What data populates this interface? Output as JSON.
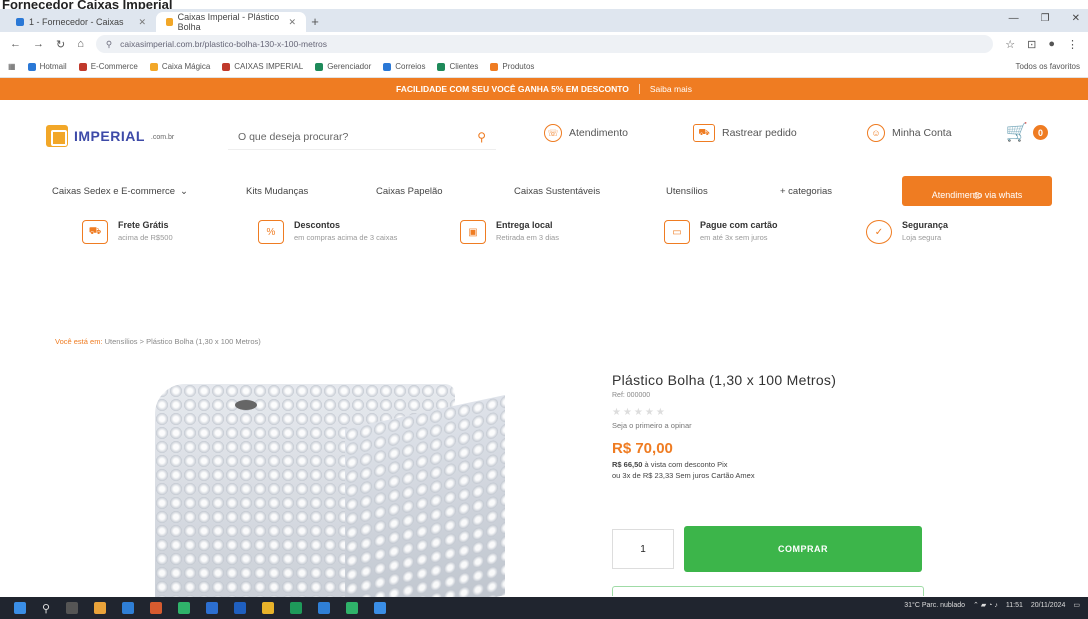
{
  "caption": "Fornecedor Caixas Imperial",
  "browser": {
    "tabs": [
      {
        "label": "1 - Fornecedor - Caixas",
        "active": false,
        "color": "#2a78d6"
      },
      {
        "label": "Caixas Imperial - Plástico Bolha",
        "active": true,
        "color": "#f2a728"
      }
    ],
    "new_tab": "+",
    "url": "caixasimperial.com.br/plastico-bolha-130-x-100-metros",
    "bookmarks": [
      {
        "label": "Hotmail",
        "color": "#2a78d6"
      },
      {
        "label": "E-Commerce",
        "color": "#c0392b"
      },
      {
        "label": "Caixa Mágica",
        "color": "#f2a728"
      },
      {
        "label": "CAIXAS IMPERIAL",
        "color": "#c0392b"
      },
      {
        "label": "Gerenciador",
        "color": "#1e8a5a"
      },
      {
        "label": "Correios",
        "color": "#2a78d6"
      },
      {
        "label": "Clientes",
        "color": "#1e8a5a"
      },
      {
        "label": "Produtos",
        "color": "#ef7c22"
      }
    ],
    "other_bookmarks": "Todos os favoritos"
  },
  "promo": {
    "text": "FACILIDADE COM SEU VOCÊ GANHA 5% EM DESCONTO",
    "cta": "Saiba mais"
  },
  "header": {
    "logo_text": "IMPERIAL",
    "logo_sub": ".com.br",
    "search_placeholder": "O que deseja procurar?",
    "atendimento": "Atendimento",
    "rastrear": "Rastrear pedido",
    "minha_conta": "Minha Conta",
    "cart_count": "0"
  },
  "nav": {
    "items": [
      "Caixas Sedex e E-commerce",
      "Kits Mudanças",
      "Caixas Papelão",
      "Caixas Sustentáveis",
      "Utensílios",
      "+ categorias"
    ],
    "cta": "Atendimento via whats"
  },
  "benefits": [
    {
      "title": "Frete Grátis",
      "sub": "acima de R$500"
    },
    {
      "title": "Descontos",
      "sub": "em compras acima de 3 caixas"
    },
    {
      "title": "Entrega local",
      "sub": "Retirada em 3 dias"
    },
    {
      "title": "Pague com cartão",
      "sub": "em até 3x sem juros"
    },
    {
      "title": "Segurança",
      "sub": "Loja segura"
    }
  ],
  "breadcrumb": {
    "home": "Você está em:",
    "path": "Utensílios > Plástico Bolha (1,30 x 100 Metros)"
  },
  "product": {
    "title": "Plástico Bolha (1,30 x 100 Metros)",
    "sku": "Ref: 000000",
    "stars": "★★★★★",
    "rating_text": "Seja o primeiro a opinar",
    "price": "R$ 70,00",
    "pix_price": "R$ 66,50",
    "pix_text": "à vista com desconto Pix",
    "installments": "ou 3x de R$ 23,33 Sem juros Cartão Amex",
    "qty": "1",
    "buy": "COMPRAR"
  },
  "colors": {
    "accent": "#ef7c22",
    "buy": "#3cb54a"
  },
  "taskbar": {
    "weather": "31°C Parc. nublado",
    "time": "11:51",
    "date": "20/11/2024"
  }
}
